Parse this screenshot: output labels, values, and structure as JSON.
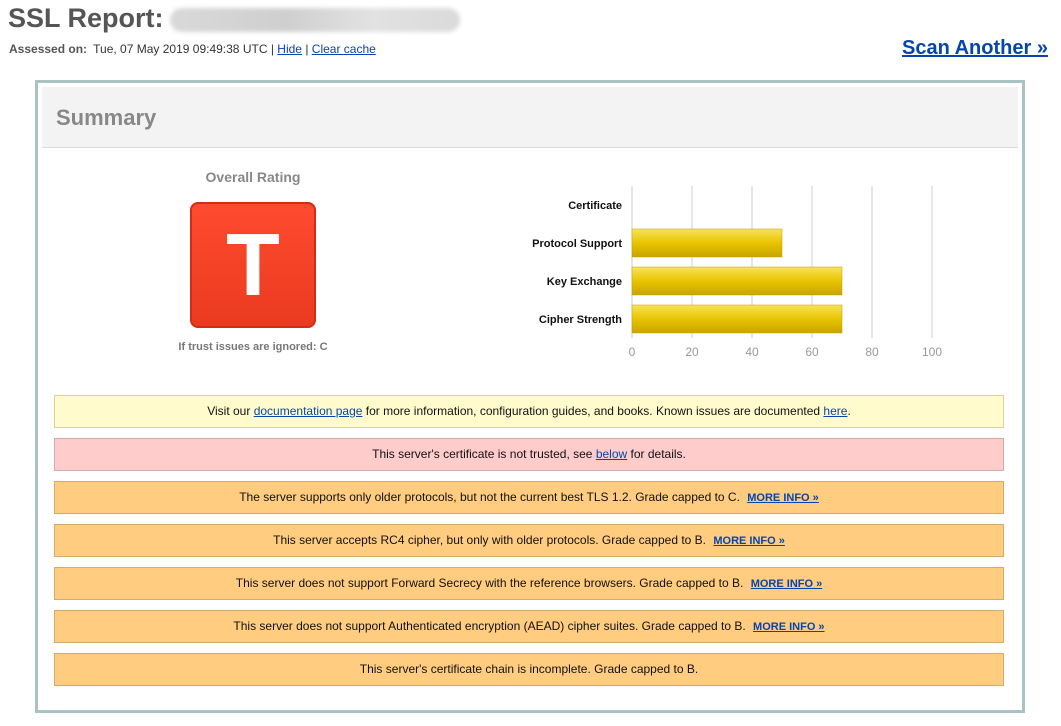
{
  "header": {
    "title": "SSL Report:",
    "assessed_label": "Assessed on:",
    "assessed_value": "Tue, 07 May 2019 09:49:38 UTC",
    "sep1": "|",
    "sep2": "|",
    "hide_link": "Hide",
    "clear_cache_link": "Clear cache",
    "scan_another": "Scan Another »"
  },
  "summary": {
    "title": "Summary",
    "overall_rating_label": "Overall Rating",
    "grade": "T",
    "grade_color": "#f0401f",
    "trust_note": "If trust issues are ignored: C"
  },
  "chart_data": {
    "type": "bar",
    "orientation": "horizontal",
    "categories": [
      "Certificate",
      "Protocol Support",
      "Key Exchange",
      "Cipher Strength"
    ],
    "values": [
      0,
      50,
      70,
      70
    ],
    "xlim": [
      0,
      100
    ],
    "xticks": [
      "0",
      "20",
      "40",
      "60",
      "80",
      "100"
    ],
    "grid": true,
    "bar_color": "#e8c000"
  },
  "notices": [
    {
      "type": "info",
      "text_before": "Visit our",
      "link1": "documentation page",
      "text_middle": "for more information, configuration guides, and books. Known issues are documented",
      "link2": "here",
      "text_after": "."
    },
    {
      "type": "error",
      "text_before": "This server's certificate is not trusted, see",
      "link1": "below",
      "text_after": "for details."
    },
    {
      "type": "warn",
      "text": "The server supports only older protocols, but not the current best TLS 1.2. Grade capped to C.",
      "more": "MORE INFO »"
    },
    {
      "type": "warn",
      "text": "This server accepts RC4 cipher, but only with older protocols. Grade capped to B.",
      "more": "MORE INFO »"
    },
    {
      "type": "warn",
      "text": "This server does not support Forward Secrecy with the reference browsers. Grade capped to B.",
      "more": "MORE INFO »"
    },
    {
      "type": "warn",
      "text": "This server does not support Authenticated encryption (AEAD) cipher suites. Grade capped to B.",
      "more": "MORE INFO »"
    },
    {
      "type": "warn",
      "text": "This server's certificate chain is incomplete. Grade capped to B."
    }
  ],
  "colors": {
    "warn_bg": "#ffcc80",
    "error_bg": "#ffcccc",
    "info_bg": "#fffbcc",
    "link": "#0645ad",
    "box_border": "#a9c3c3"
  }
}
